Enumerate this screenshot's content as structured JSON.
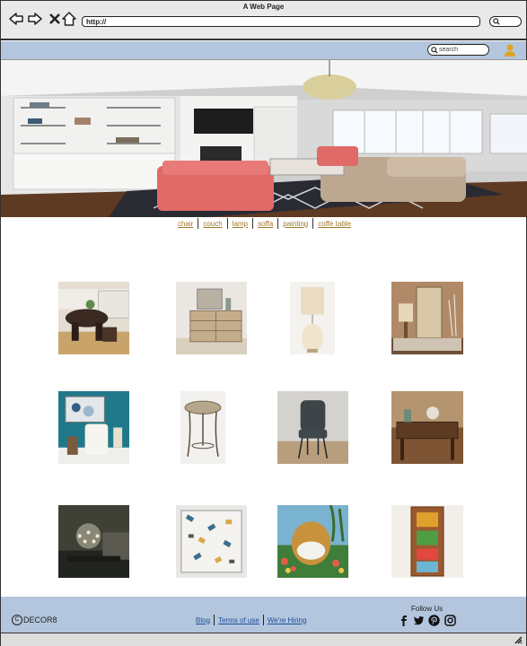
{
  "browser": {
    "title": "A Web Page",
    "url": "http://"
  },
  "header": {
    "search_placeholder": "search"
  },
  "categories": [
    "chair",
    "couch",
    "lamp",
    "soffa",
    "painting",
    "coffe table"
  ],
  "footer": {
    "brand": "DECOR8",
    "copyright_symbol": "C",
    "links": [
      "Blog",
      "Terms of use",
      "We're Hiring"
    ],
    "follow_label": "Follow Us"
  },
  "icons": [
    "back-icon",
    "forward-icon",
    "close-icon",
    "home-icon",
    "search-icon",
    "user-icon",
    "facebook-icon",
    "twitter-icon",
    "pinterest-icon",
    "instagram-icon"
  ],
  "colors": {
    "nav_bar": "#b3c6dd",
    "category_link": "#a0782d",
    "footer_link": "#1c4f9c"
  }
}
